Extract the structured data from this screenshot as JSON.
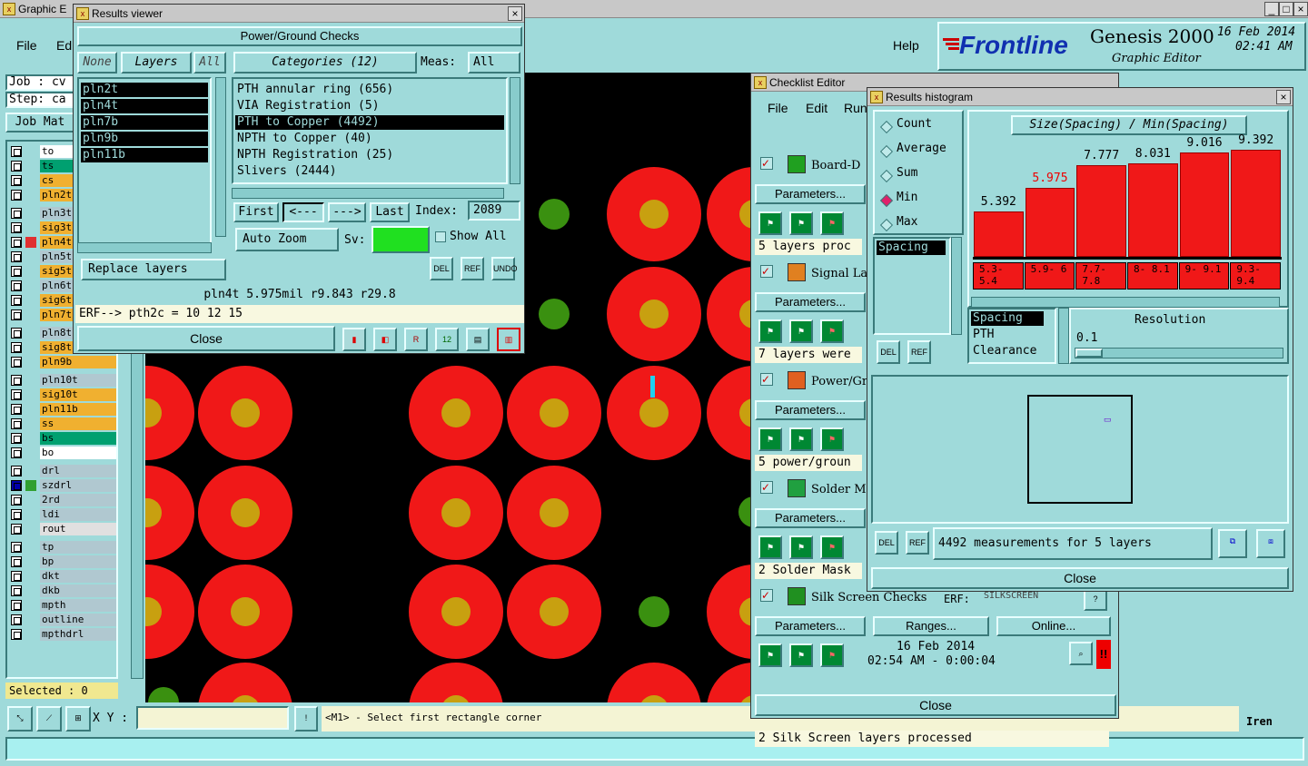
{
  "main_window": {
    "title": "Graphic E",
    "menu": {
      "file": "File",
      "edit": "Ed",
      "help": "Help"
    },
    "job_label": "Job : cv",
    "step_label": "Step: ca",
    "job_matrix_button": "Job Mat",
    "selected_label": "Selected : 0",
    "brand": "Frontline",
    "product": "Genesis 2000",
    "subtitle": "Graphic Editor",
    "date": "16 Feb 2014",
    "time": "02:41 AM",
    "xy_label": "X Y :",
    "status_message": "<M1> - Select first rectangle corner",
    "menu_label": "Iren"
  },
  "layers": [
    {
      "name": "to",
      "color": "#ffffff"
    },
    {
      "name": "ts",
      "color": "#00a070"
    },
    {
      "name": "cs",
      "color": "#f0b030"
    },
    {
      "name": "pln2t",
      "color": "#f0b030"
    },
    {
      "name": "pln3t",
      "color": "#b0c8d0"
    },
    {
      "name": "sig3t",
      "color": "#f0b030"
    },
    {
      "name": "pln4t",
      "color": "#f0b030"
    },
    {
      "name": "pln5t",
      "color": "#b0c8d0"
    },
    {
      "name": "sig5t",
      "color": "#f0b030"
    },
    {
      "name": "pln6t",
      "color": "#b0c8d0"
    },
    {
      "name": "sig6t",
      "color": "#f0b030"
    },
    {
      "name": "pln7t",
      "color": "#f0b030"
    },
    {
      "name": "pln8t",
      "color": "#b0c8d0"
    },
    {
      "name": "sig8t",
      "color": "#f0b030"
    },
    {
      "name": "pln9b",
      "color": "#f0b030"
    },
    {
      "name": "pln10t",
      "color": "#b0c8d0"
    },
    {
      "name": "sig10t",
      "color": "#f0b030"
    },
    {
      "name": "pln11b",
      "color": "#f0b030"
    },
    {
      "name": "ss",
      "color": "#f0b030"
    },
    {
      "name": "bs",
      "color": "#00a070"
    },
    {
      "name": "bo",
      "color": "#ffffff"
    },
    {
      "name": "drl",
      "color": "#b0c8d0"
    },
    {
      "name": "szdrl",
      "color": "#b0c8d0"
    },
    {
      "name": "2rd",
      "color": "#b0c8d0"
    },
    {
      "name": "ldi",
      "color": "#b0c8d0"
    },
    {
      "name": "rout",
      "color": "#e0e0e0"
    },
    {
      "name": "tp",
      "color": "#b0c8d0"
    },
    {
      "name": "bp",
      "color": "#b0c8d0"
    },
    {
      "name": "dkt",
      "color": "#b0c8d0"
    },
    {
      "name": "dkb",
      "color": "#b0c8d0"
    },
    {
      "name": "mpth",
      "color": "#b0c8d0"
    },
    {
      "name": "outline",
      "color": "#b0c8d0"
    },
    {
      "name": "mpthdrl",
      "color": "#b0c8d0"
    }
  ],
  "results_viewer": {
    "title": "Results viewer",
    "heading": "Power/Ground Checks",
    "none_button": "None",
    "layers_label": "Layers",
    "all_button": "All",
    "layer_list": [
      "pln2t",
      "pln4t",
      "pln7b",
      "pln9b",
      "pln11b"
    ],
    "categories_label": "Categories (12)",
    "meas_label": "Meas:",
    "meas_value": "All",
    "categories": [
      "PTH annular ring (656)",
      "VIA Registration (5)",
      "PTH to Copper (4492)",
      "NPTH to Copper (40)",
      "NPTH Registration (25)",
      "Slivers (2444)"
    ],
    "first_button": "First",
    "prev_button": "<---",
    "next_button": "--->",
    "last_button": "Last",
    "index_label": "Index:",
    "index_value": "2089",
    "auto_zoom_label": "Auto Zoom",
    "sv_label": "Sv:",
    "show_all_label": "Show All",
    "replace_layers_label": "Replace layers",
    "info_line": "pln4t 5.975mil  r9.843  r29.8",
    "erf_line": "ERF--> pth2c = 10 12 15",
    "close_button": "Close",
    "del_label": "DEL",
    "ref_label": "REF",
    "undo_label": "UNDO"
  },
  "checklist_editor": {
    "title": "Checklist Editor",
    "menu": {
      "file": "File",
      "edit": "Edit",
      "run": "Run"
    },
    "items": [
      {
        "name": "Board-D",
        "status": "5 layers proc"
      },
      {
        "name": "Signal La",
        "status": "7 layers were"
      },
      {
        "name": "Power/Gr",
        "status": "5 power/groun"
      },
      {
        "name": "Solder M",
        "status": "2 Solder Mask"
      },
      {
        "name": "Silk Screen Checks",
        "status": "2 Silk Screen layers processed"
      }
    ],
    "parameters_label": "Parameters...",
    "ranges_label": "Ranges...",
    "online_label": "Online...",
    "erf_label": "ERF:",
    "erf_value": "SILKSCREEN",
    "run_date": "16 Feb 2014",
    "run_time": "02:54 AM - 0:00:04",
    "close_button": "Close"
  },
  "histogram": {
    "title": "Results histogram",
    "options": [
      "Count",
      "Average",
      "Sum",
      "Min",
      "Max"
    ],
    "selected_option": "Min",
    "chart_title": "Size(Spacing) / Min(Spacing)",
    "bars": [
      {
        "value": "5.392",
        "range": "5.3- 5.4",
        "height": 0.4
      },
      {
        "value": "5.975",
        "range": "5.9- 6",
        "height": 0.6
      },
      {
        "value": "7.777",
        "range": "7.7- 7.8",
        "height": 0.8
      },
      {
        "value": "8.031",
        "range": "8- 8.1",
        "height": 0.82
      },
      {
        "value": "9.016",
        "range": "9- 9.1",
        "height": 0.91
      },
      {
        "value": "9.392",
        "range": "9.3- 9.4",
        "height": 0.94
      }
    ],
    "highlight_index": 1,
    "list_selected": "Spacing",
    "measure_list": [
      "Spacing",
      "PTH",
      "Clearance"
    ],
    "resolution_label": "Resolution",
    "resolution_value": "0.1",
    "summary": "4492 measurements for 5 layers",
    "close_button": "Close",
    "del_label": "DEL",
    "ref_label": "REF"
  }
}
